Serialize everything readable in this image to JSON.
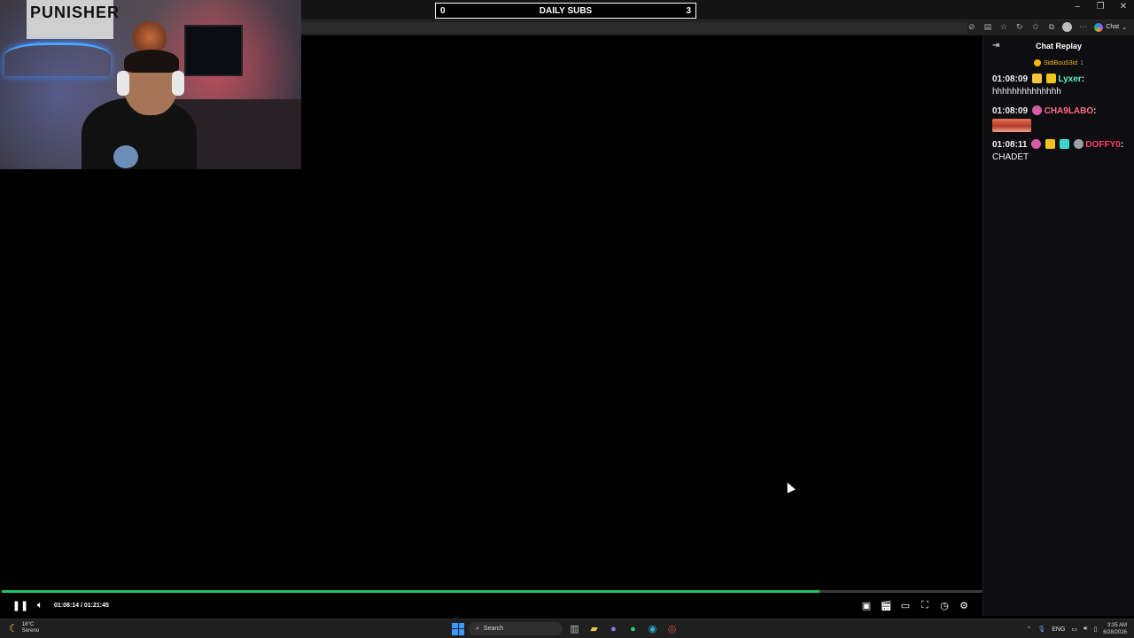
{
  "browser": {
    "copilot_label": "Chat"
  },
  "overlay": {
    "subs_left": "0",
    "subs_title": "DAILY SUBS",
    "subs_right": "3",
    "poster_text": "PUNISHER"
  },
  "chat": {
    "title": "Chat Replay",
    "pinned_user": "SidiBouS3id",
    "pinned_count": "1",
    "messages": [
      {
        "time": "01:08:09",
        "user": "Lyxer",
        "user_color": "#5ef0c8",
        "text": "hhhhhhhhhhhhhh"
      },
      {
        "time": "01:08:09",
        "user": "CHA9LABO",
        "user_color": "#ff6b8a",
        "text": ""
      },
      {
        "time": "01:08:11",
        "user": "DOFFY0",
        "user_color": "#ff3b6b",
        "text": "CHADET"
      }
    ]
  },
  "player": {
    "current_time": "01:08:14",
    "duration": "01:21:45",
    "time_display": "01:08:14 / 01:21:45",
    "progress_fraction": 0.834,
    "accent": "#22c55e"
  },
  "taskbar": {
    "weather_temp": "18°C",
    "weather_desc": "Sereno",
    "search_placeholder": "Search",
    "lang": "ENG",
    "time": "3:35 AM",
    "date": "6/28/2026"
  }
}
